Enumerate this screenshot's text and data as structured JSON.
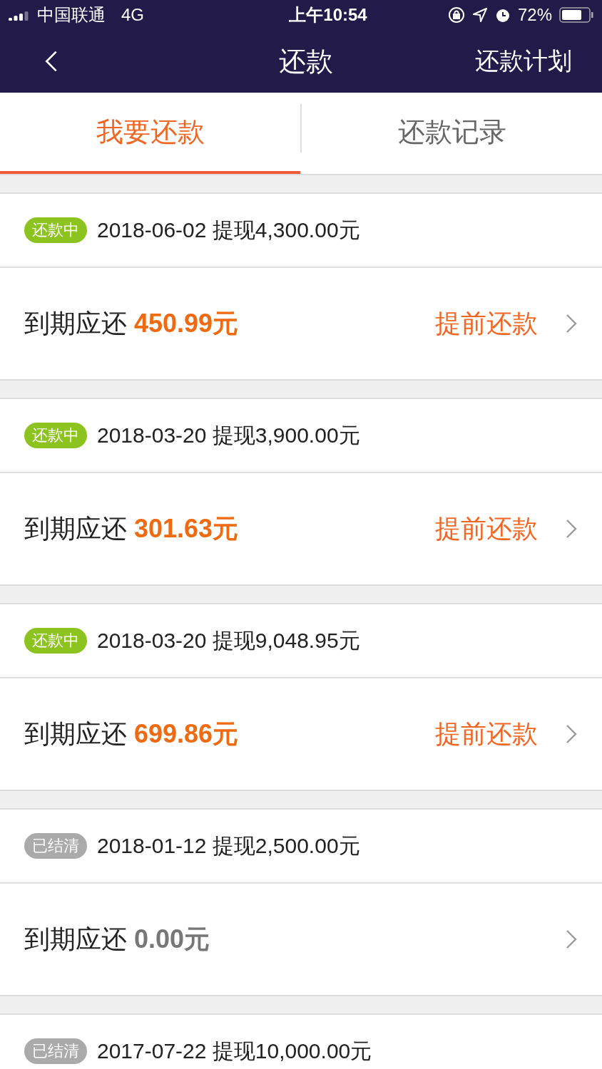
{
  "status_bar": {
    "carrier": "中国联通",
    "network": "4G",
    "time": "上午10:54",
    "battery": "72%"
  },
  "nav": {
    "title": "还款",
    "action": "还款计划"
  },
  "tabs": [
    {
      "label": "我要还款",
      "selected": true
    },
    {
      "label": "还款记录",
      "selected": false
    }
  ],
  "loans": [
    {
      "status": {
        "kind": "repaying",
        "label": "还款中"
      },
      "summary": "2018-06-02 提现4,300.00元",
      "due_label": "到期应还",
      "amount": "450.99元",
      "action": "提前还款"
    },
    {
      "status": {
        "kind": "repaying",
        "label": "还款中"
      },
      "summary": "2018-03-20 提现3,900.00元",
      "due_label": "到期应还",
      "amount": "301.63元",
      "action": "提前还款"
    },
    {
      "status": {
        "kind": "repaying",
        "label": "还款中"
      },
      "summary": "2018-03-20 提现9,048.95元",
      "due_label": "到期应还",
      "amount": "699.86元",
      "action": "提前还款"
    },
    {
      "status": {
        "kind": "settled",
        "label": "已结清"
      },
      "summary": "2018-01-12 提现2,500.00元",
      "due_label": "到期应还",
      "amount": "0.00元"
    },
    {
      "status": {
        "kind": "settled",
        "label": "已结清"
      },
      "summary": "2017-07-22 提现10,000.00元"
    }
  ]
}
